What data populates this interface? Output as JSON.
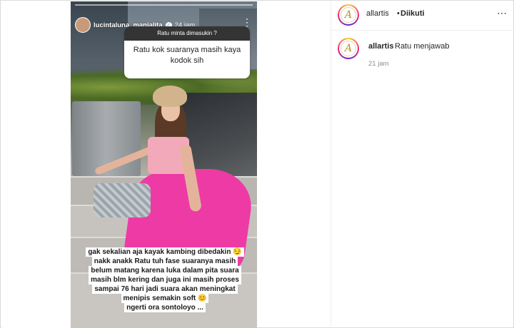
{
  "story": {
    "username": "lucintaluna_manjalita",
    "time": "24 jam",
    "question": {
      "header": "Ratu minta dimasukin ?",
      "body": "Ratu kok suaranya masih kaya kodok sih"
    },
    "answer_lines": [
      "gak sekalian aja kayak kambing dibedakin 😏",
      "nakk anakk Ratu tuh fase suaranya masih",
      "belum matang karena luka dalam pita suara",
      "masih blm kering dan juga ini masih proses",
      "sampai 76 hari jadi suara akan meningkat",
      "menipis semakin soft 😊",
      "ngerti ora sontoloyo ..."
    ]
  },
  "post": {
    "avatar_letter": "A",
    "username": "allartis",
    "separator": "•",
    "follow_status": "Diikuti",
    "more_icon": "⋯"
  },
  "comment": {
    "avatar_letter": "A",
    "username": "allartis",
    "text": "Ratu menjawab",
    "time": "21 jam"
  }
}
